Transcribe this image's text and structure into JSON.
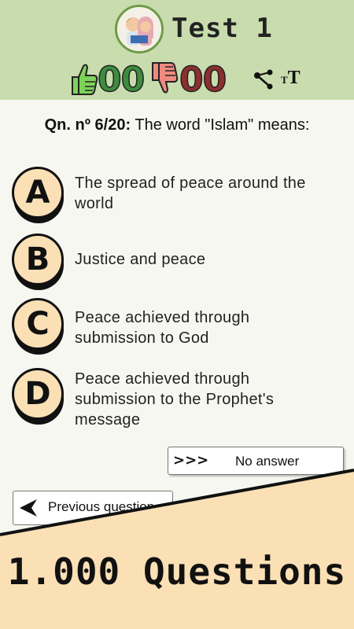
{
  "header": {
    "title": "Test 1",
    "correct_count": "00",
    "wrong_count": "00",
    "colors": {
      "header_bg": "#c9dcae",
      "correct": "#3d8c3f",
      "wrong": "#8c2f2f"
    }
  },
  "question": {
    "prefix": "Qn. nº 6/20:",
    "text": " The word \"Islam\" means:"
  },
  "options": [
    {
      "letter": "A",
      "text": " The spread of peace around the world"
    },
    {
      "letter": "B",
      "text": " Justice and peace"
    },
    {
      "letter": "C",
      "text": " Peace achieved through submission to God"
    },
    {
      "letter": "D",
      "text": " Peace achieved through submission to the Prophet's message"
    }
  ],
  "buttons": {
    "no_answer_arrows": ">>>",
    "no_answer_label": "No answer",
    "previous_label": "Previous question"
  },
  "promo": {
    "text": "1.000 Questions",
    "band_color": "#fbe0b6"
  },
  "icons": [
    "thumbs-up-icon",
    "thumbs-down-icon",
    "share-icon",
    "font-size-icon",
    "back-arrow-icon",
    "kids-reading-avatar"
  ]
}
